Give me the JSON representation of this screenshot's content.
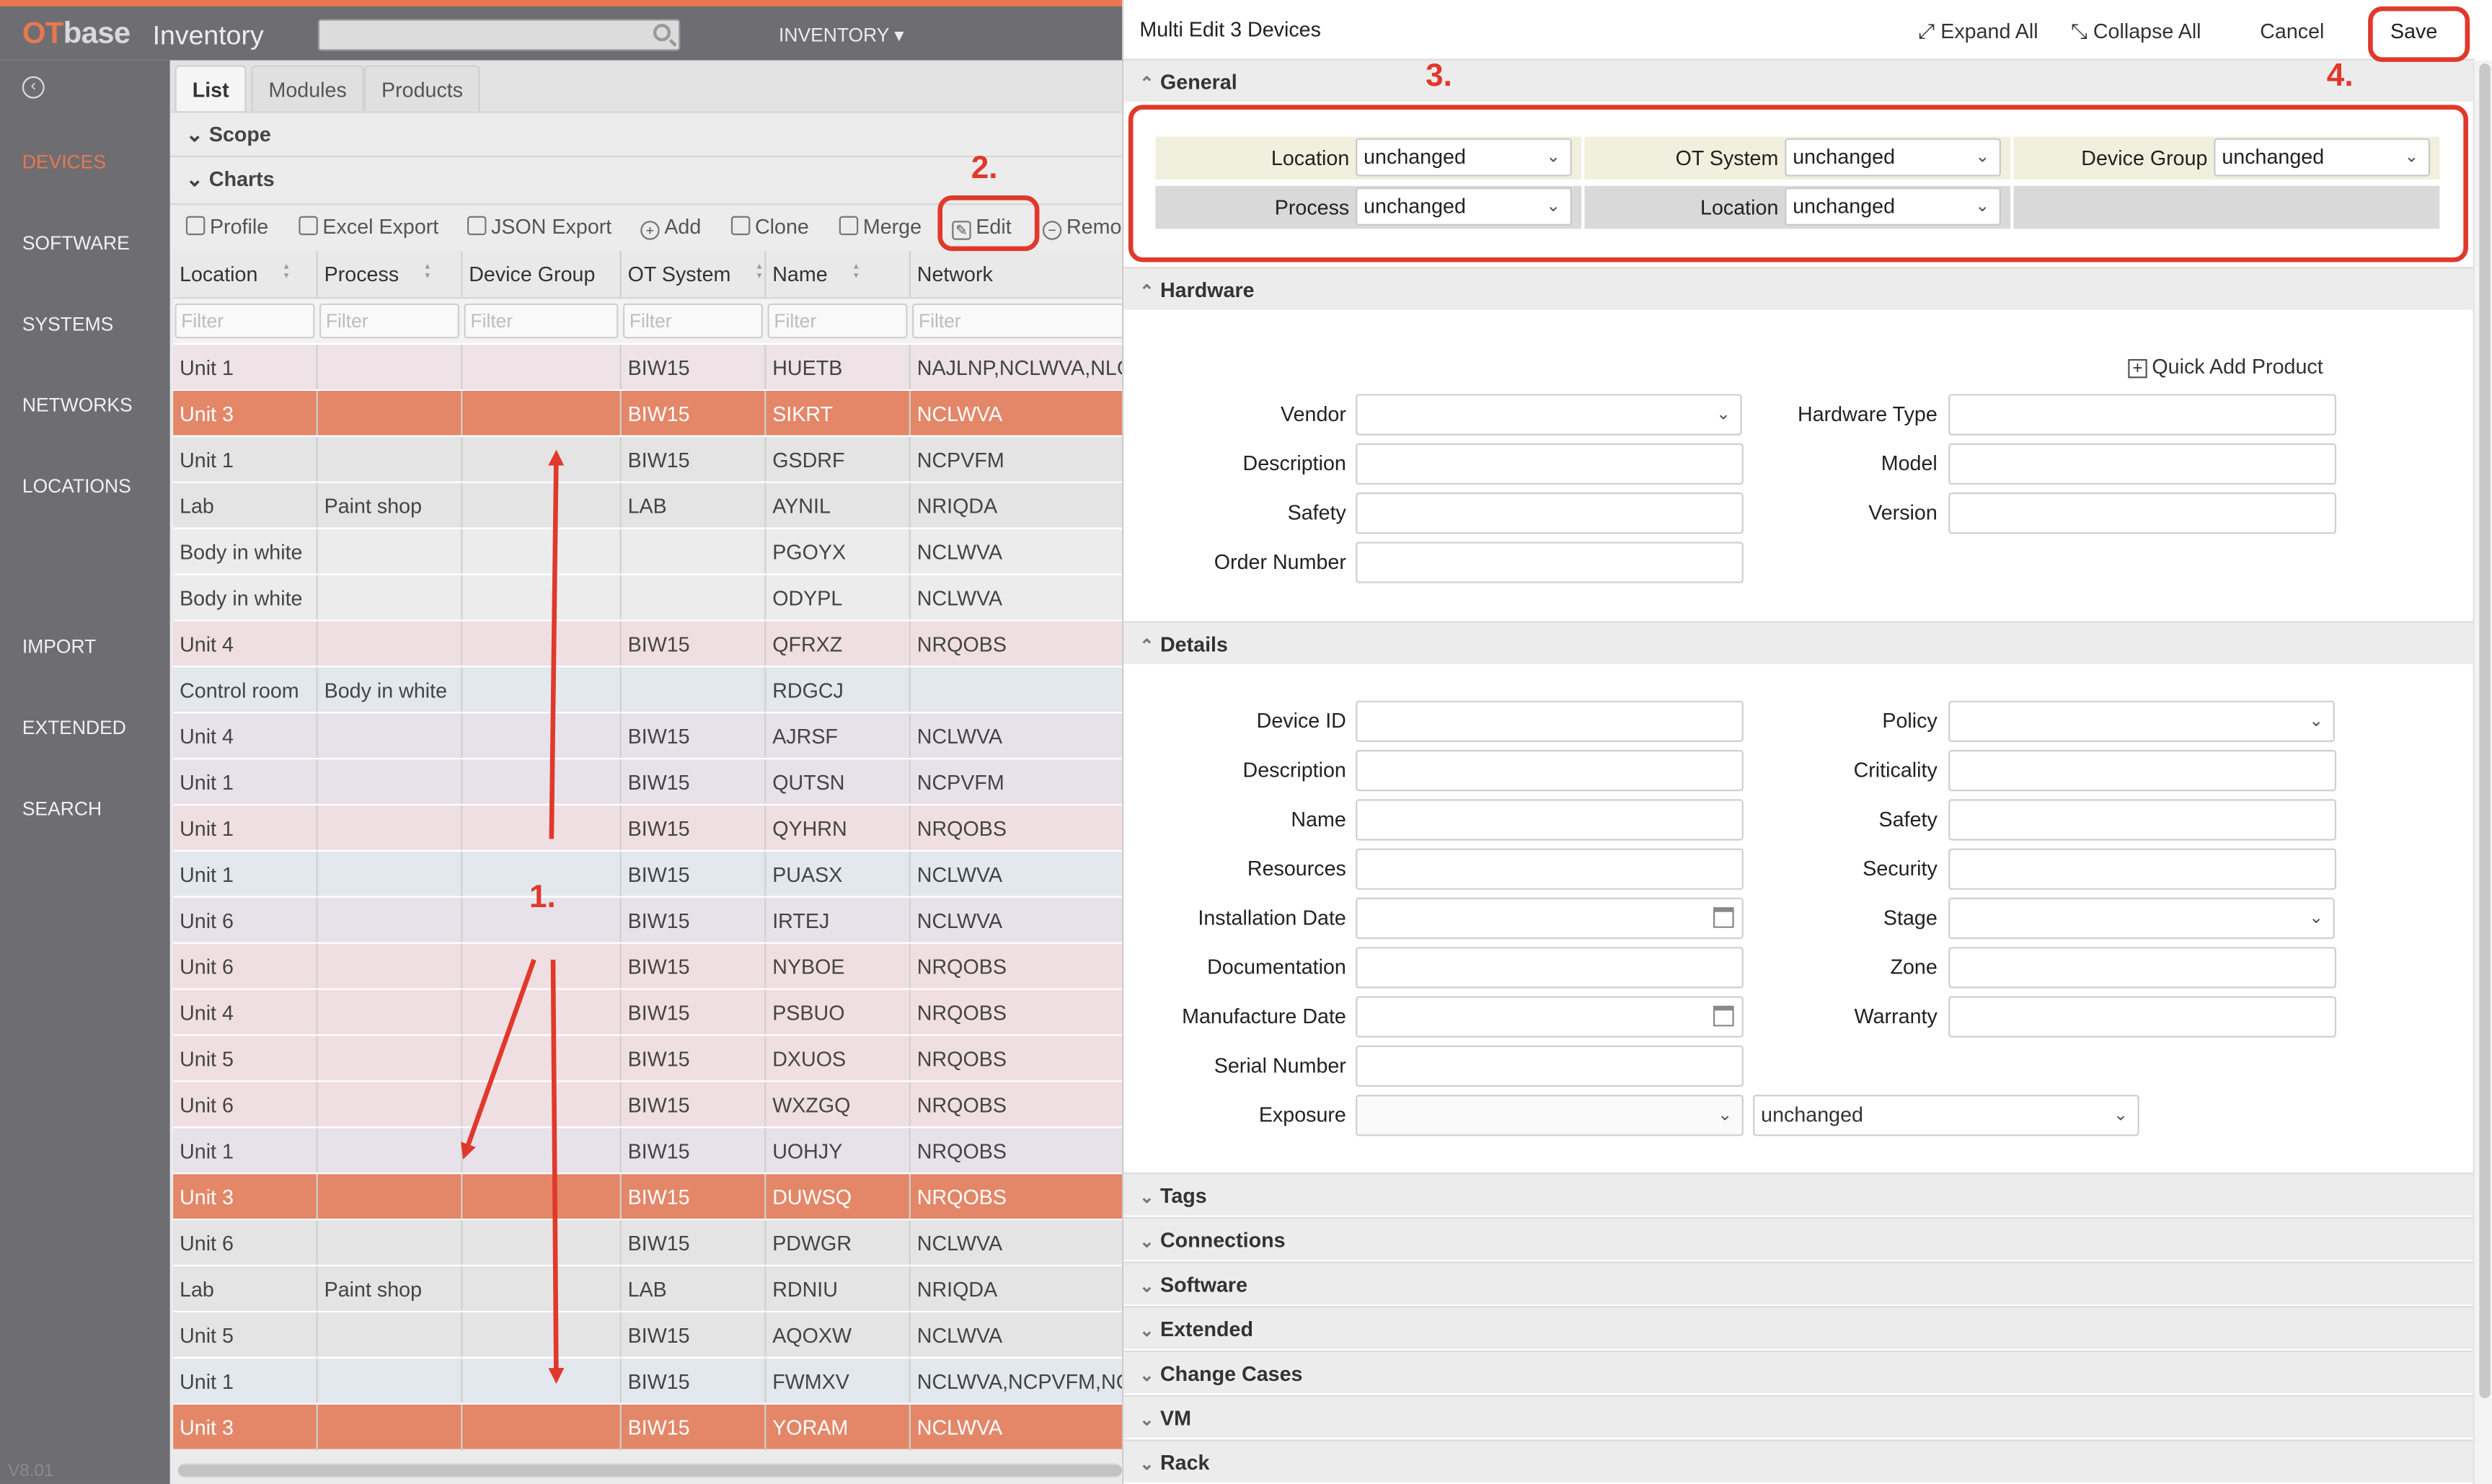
{
  "app": {
    "logo_ot": "OT",
    "logo_base": "base",
    "title": "Inventory",
    "top_menu": "INVENTORY ▾",
    "version": "V8.01"
  },
  "sidebar": {
    "items": [
      {
        "label": "DEVICES",
        "active": true
      },
      {
        "label": "SOFTWARE"
      },
      {
        "label": "SYSTEMS"
      },
      {
        "label": "NETWORKS"
      },
      {
        "label": "LOCATIONS"
      },
      {
        "label": "IMPORT"
      },
      {
        "label": "EXTENDED"
      },
      {
        "label": "SEARCH"
      }
    ]
  },
  "list": {
    "tabs": [
      "List",
      "Modules",
      "Products"
    ],
    "sections": {
      "scope": "Scope",
      "charts": "Charts"
    },
    "toolbar": [
      "Profile",
      "Excel Export",
      "JSON Export",
      "Add",
      "Clone",
      "Merge",
      "Edit",
      "Remo"
    ],
    "columns": [
      "Location",
      "Process",
      "Device Group",
      "OT System",
      "Name",
      "Network"
    ],
    "filter_placeholder": "Filter",
    "rows": [
      [
        "Unit 1",
        "",
        "",
        "BIW15",
        "HUETB",
        "NAJLNP,NCLWVA,NLC"
      ],
      [
        "Unit 3",
        "",
        "",
        "BIW15",
        "SIKRT",
        "NCLWVA"
      ],
      [
        "Unit 1",
        "",
        "",
        "BIW15",
        "GSDRF",
        "NCPVFM"
      ],
      [
        "Lab",
        "Paint shop",
        "",
        "LAB",
        "AYNIL",
        "NRIQDA"
      ],
      [
        "Body in white",
        "",
        "",
        "",
        "PGOYX",
        "NCLWVA"
      ],
      [
        "Body in white",
        "",
        "",
        "",
        "ODYPL",
        "NCLWVA"
      ],
      [
        "Unit 4",
        "",
        "",
        "BIW15",
        "QFRXZ",
        "NRQOBS"
      ],
      [
        "Control room",
        "Body in white",
        "",
        "",
        "RDGCJ",
        ""
      ],
      [
        "Unit 4",
        "",
        "",
        "BIW15",
        "AJRSF",
        "NCLWVA"
      ],
      [
        "Unit 1",
        "",
        "",
        "BIW15",
        "QUTSN",
        "NCPVFM"
      ],
      [
        "Unit 1",
        "",
        "",
        "BIW15",
        "QYHRN",
        "NRQOBS"
      ],
      [
        "Unit 1",
        "",
        "",
        "BIW15",
        "PUASX",
        "NCLWVA"
      ],
      [
        "Unit 6",
        "",
        "",
        "BIW15",
        "IRTEJ",
        "NCLWVA"
      ],
      [
        "Unit 6",
        "",
        "",
        "BIW15",
        "NYBOE",
        "NRQOBS"
      ],
      [
        "Unit 4",
        "",
        "",
        "BIW15",
        "PSBUO",
        "NRQOBS"
      ],
      [
        "Unit 5",
        "",
        "",
        "BIW15",
        "DXUOS",
        "NRQOBS"
      ],
      [
        "Unit 6",
        "",
        "",
        "BIW15",
        "WXZGQ",
        "NRQOBS"
      ],
      [
        "Unit 1",
        "",
        "",
        "BIW15",
        "UOHJY",
        "NRQOBS"
      ],
      [
        "Unit 3",
        "",
        "",
        "BIW15",
        "DUWSQ",
        "NRQOBS"
      ],
      [
        "Unit 6",
        "",
        "",
        "BIW15",
        "PDWGR",
        "NCLWVA"
      ],
      [
        "Lab",
        "Paint shop",
        "",
        "LAB",
        "RDNIU",
        "NRIQDA"
      ],
      [
        "Unit 5",
        "",
        "",
        "BIW15",
        "AQOXW",
        "NCLWVA"
      ],
      [
        "Unit 1",
        "",
        "",
        "BIW15",
        "FWMXV",
        "NCLWVA,NCPVFM,NC"
      ],
      [
        "Unit 3",
        "",
        "",
        "BIW15",
        "YORAM",
        "NCLWVA"
      ]
    ],
    "selected_rows": [
      1,
      18,
      23
    ],
    "row_tints": [
      "#efe3e8",
      "#e38768",
      "#e4e4e4",
      "#e4e4e4",
      "#ececec",
      "#ececec",
      "#f0dfe2",
      "#e2e8ee",
      "#e7e2ea",
      "#e7e2ea",
      "#f0dfe2",
      "#e2e8ee",
      "#e7e2ea",
      "#f0dfe2",
      "#f0dfe2",
      "#f0dfe2",
      "#f0dfe2",
      "#e7e2ea",
      "#e38768",
      "#e4e4e4",
      "#e4e4e4",
      "#e4e4e4",
      "#e2e8ee",
      "#e38768"
    ]
  },
  "panel": {
    "title": "Multi Edit 3 Devices",
    "expand_all": "Expand All",
    "collapse_all": "Collapse All",
    "cancel": "Cancel",
    "save": "Save",
    "general": {
      "title": "General",
      "location": "Location",
      "location_value": "unchanged",
      "ot_system": "OT System",
      "ot_system_value": "unchanged",
      "device_group": "Device Group",
      "device_group_value": "unchanged",
      "process": "Process",
      "process_value": "unchanged",
      "location2": "Location",
      "location2_value": "unchanged"
    },
    "hardware": {
      "title": "Hardware",
      "quick_add": "Quick Add Product",
      "vendor": "Vendor",
      "description": "Description",
      "safety": "Safety",
      "order_number": "Order Number",
      "hardware_type": "Hardware Type",
      "model": "Model",
      "version": "Version"
    },
    "details": {
      "title": "Details",
      "device_id": "Device ID",
      "description": "Description",
      "name": "Name",
      "resources": "Resources",
      "installation_date": "Installation Date",
      "documentation": "Documentation",
      "manufacture_date": "Manufacture Date",
      "serial_number": "Serial Number",
      "exposure": "Exposure",
      "exposure_value": "unchanged",
      "policy": "Policy",
      "criticality": "Criticality",
      "safety": "Safety",
      "security": "Security",
      "stage": "Stage",
      "zone": "Zone",
      "warranty": "Warranty"
    },
    "collapsed_sections": [
      "Tags",
      "Connections",
      "Software",
      "Extended",
      "Change Cases",
      "VM",
      "Rack"
    ]
  },
  "annotations": {
    "step1": "1.",
    "step2": "2.",
    "step3": "3.",
    "step4": "4.",
    "color": "#e0392b"
  }
}
